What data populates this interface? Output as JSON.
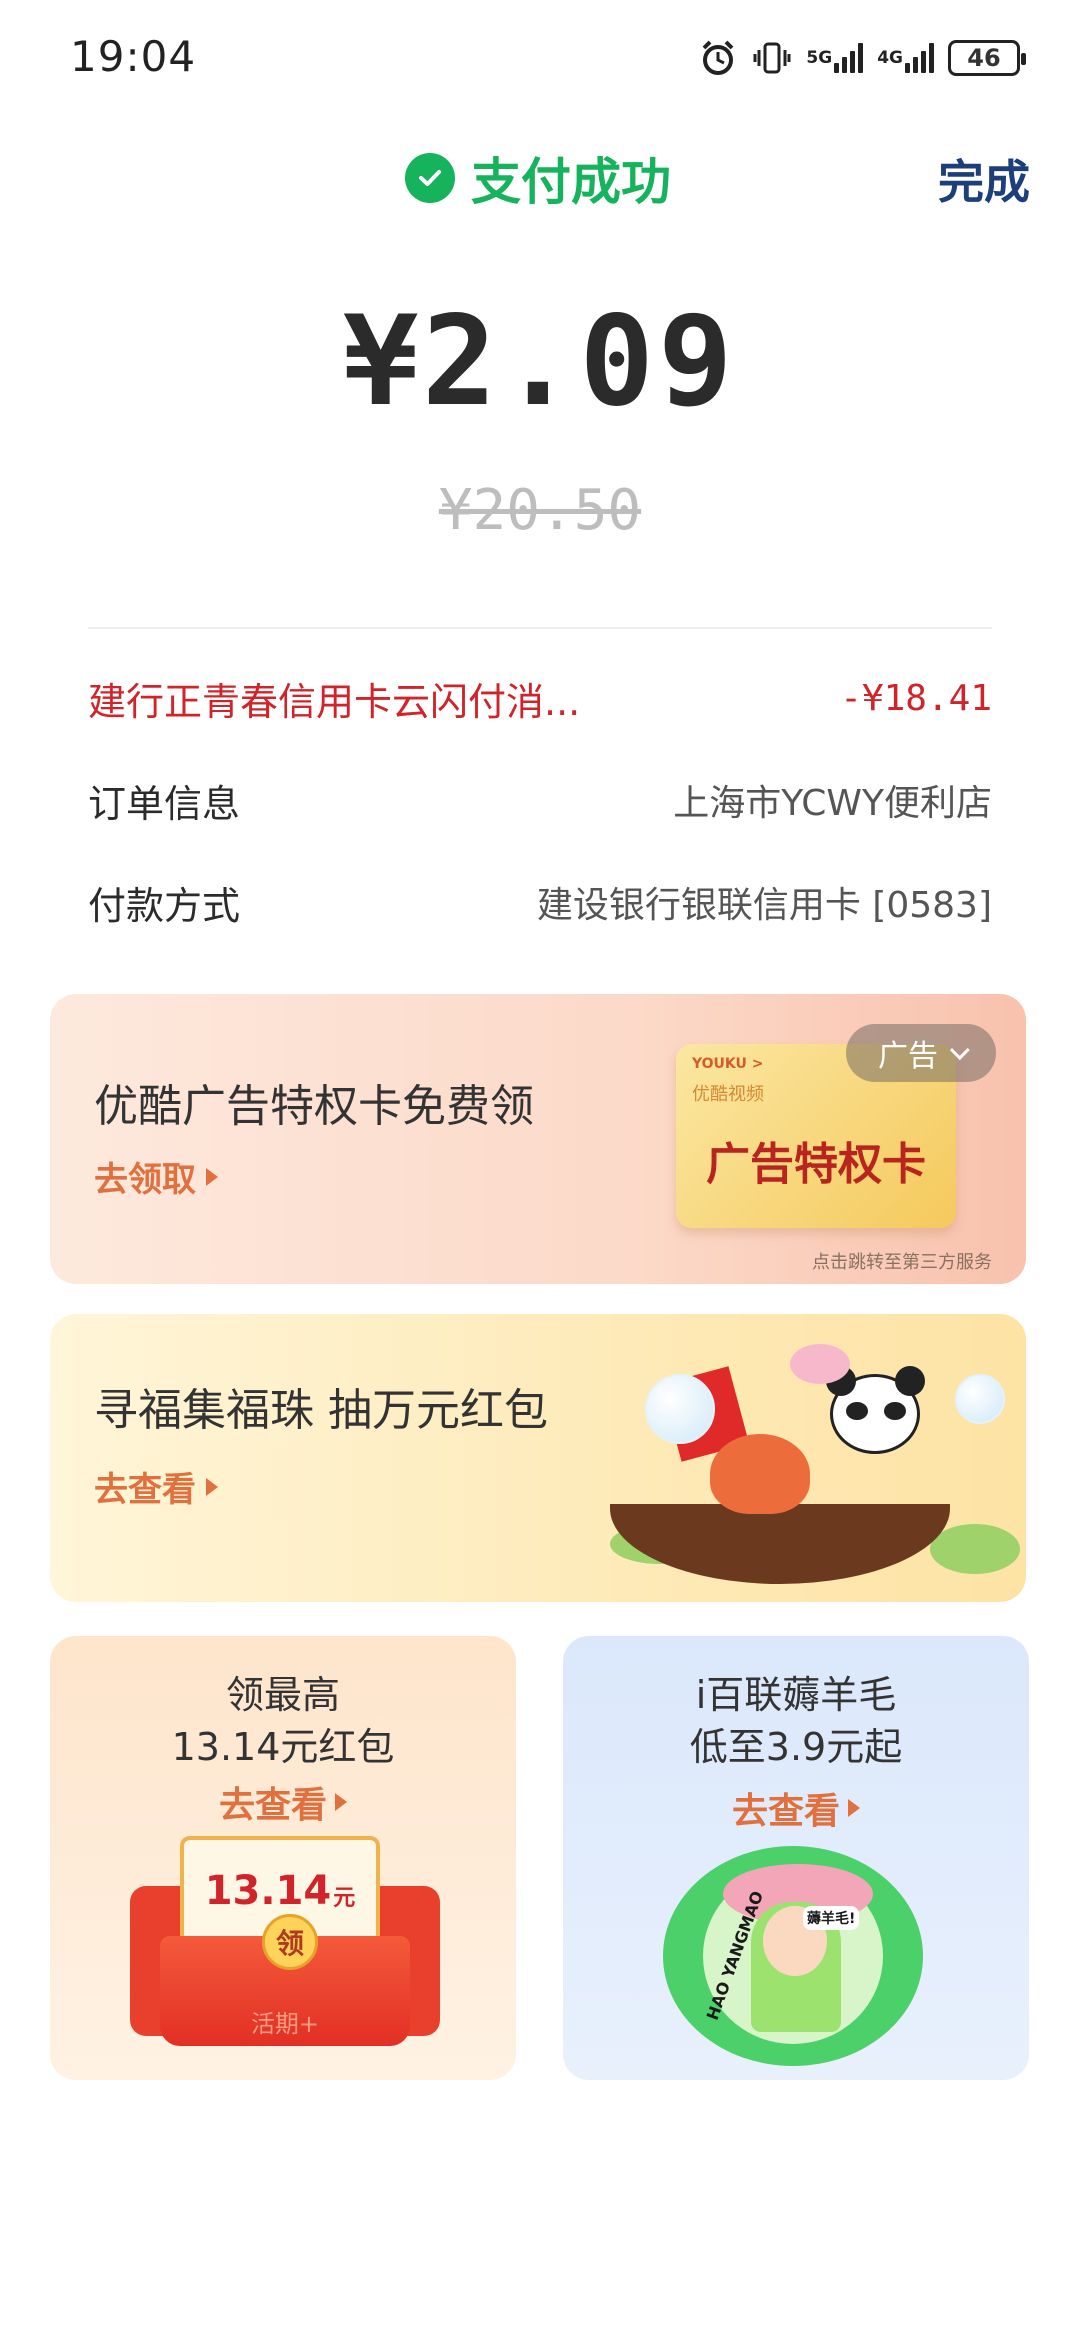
{
  "status_bar": {
    "time": "19:04",
    "network_1": "5G",
    "network_2": "4G",
    "battery": "46",
    "icons": [
      "alarm-icon",
      "vibrate-icon",
      "signal-5g-icon",
      "signal-4g-icon",
      "battery-icon"
    ]
  },
  "header": {
    "success_text": "支付成功",
    "done_label": "完成",
    "success_color": "#15b35c",
    "done_color": "#1c3e7a"
  },
  "payment": {
    "amount": "¥2.09",
    "original_amount": "¥20.50"
  },
  "details": [
    {
      "key": "建行正青春信用卡云闪付消...",
      "value": "-¥18.41",
      "highlight_color": "#d0242a"
    },
    {
      "key": "订单信息",
      "value": "上海市YCWY便利店"
    },
    {
      "key": "付款方式",
      "value": "建设银行银联信用卡 [0583]"
    }
  ],
  "ad_card": {
    "title": "优酷广告特权卡免费领",
    "link": "去领取",
    "badge": "广告",
    "card_logo": "YOUKU >",
    "card_sub": "优酷视频",
    "card_main": "广告特权卡",
    "footnote": "点击跳转至第三方服务"
  },
  "promo_card": {
    "title": "寻福集福珠 抽万元红包",
    "link": "去查看"
  },
  "grid": [
    {
      "line1": "领最高",
      "line2": "13.14元红包",
      "link": "去查看",
      "envelope_amount": "13.14",
      "envelope_unit": "元",
      "coin_text": "领",
      "envelope_note": "活期+"
    },
    {
      "line1": "i百联薅羊毛",
      "line2": "低至3.9元起",
      "link": "去查看",
      "arc_text": "HAO YANGMAO",
      "sticker": "薅羊毛!"
    }
  ],
  "accent_color": "#e0703e"
}
